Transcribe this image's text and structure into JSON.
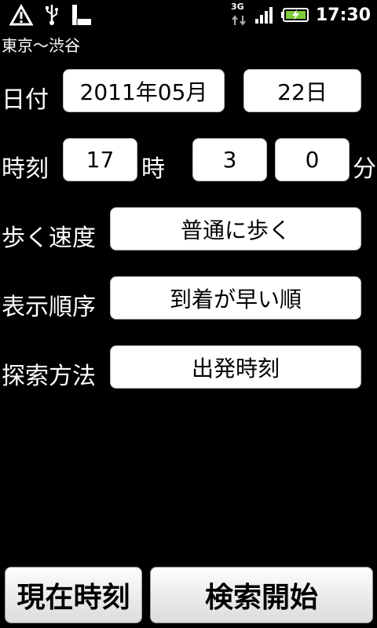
{
  "status_bar": {
    "time": "17:30",
    "network": "3G",
    "icons": [
      "warning-icon",
      "usb-icon",
      "sd-card-icon",
      "data-arrows-icon",
      "signal-icon",
      "battery-charging-icon"
    ]
  },
  "header": {
    "route": "東京～渋谷"
  },
  "form": {
    "date": {
      "label": "日付",
      "year_month": "2011年05月",
      "day": "22日"
    },
    "time": {
      "label": "時刻",
      "hour": "17",
      "hour_unit": "時",
      "min_tens": "3",
      "min_ones": "0",
      "min_unit": "分"
    },
    "walk_speed": {
      "label": "歩く速度",
      "value": "普通に歩く"
    },
    "display_order": {
      "label": "表示順序",
      "value": "到着が早い順"
    },
    "search_method": {
      "label": "探索方法",
      "value": "出発時刻"
    }
  },
  "buttons": {
    "current_time": "現在時刻",
    "start_search": "検索開始"
  }
}
